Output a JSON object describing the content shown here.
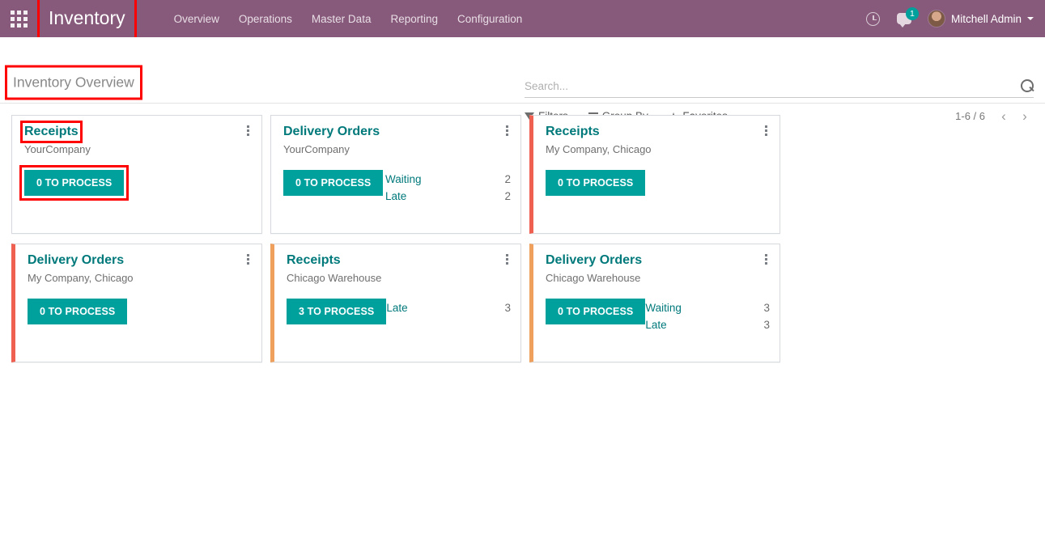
{
  "navbar": {
    "apps_icon": "apps-grid-icon",
    "brand": "Inventory",
    "menus": [
      "Overview",
      "Operations",
      "Master Data",
      "Reporting",
      "Configuration"
    ],
    "activities_icon": "clock-icon",
    "messages_icon": "chat-bubble-icon",
    "messages_count": "1",
    "user_name": "Mitchell Admin",
    "brand_color": "#875A7B"
  },
  "control_panel": {
    "breadcrumb": "Inventory Overview",
    "search": {
      "value": "",
      "placeholder": "Search...",
      "icon": "search-icon"
    },
    "filters_label": "Filters",
    "group_by_label": "Group By",
    "favorites_label": "Favorites",
    "pager": {
      "text": "1-6 / 6",
      "prev": "‹",
      "next": "›"
    }
  },
  "highlights": {
    "color": "#FF0000",
    "targets": [
      "brand",
      "breadcrumb",
      "card-0-title",
      "card-0-button"
    ]
  },
  "colors": {
    "accent_teal": "#00A09D",
    "title_teal": "#00797B",
    "stripe_red": "#F06050",
    "stripe_orange": "#EFA05C"
  },
  "kanban": {
    "cards": [
      {
        "title": "Receipts",
        "subtitle": "YourCompany",
        "button": "0 TO PROCESS",
        "stripe": "none",
        "stats": []
      },
      {
        "title": "Delivery Orders",
        "subtitle": "YourCompany",
        "button": "0 TO PROCESS",
        "stripe": "none",
        "stats": [
          {
            "label": "Waiting",
            "value": "2"
          },
          {
            "label": "Late",
            "value": "2"
          }
        ]
      },
      {
        "title": "Receipts",
        "subtitle": "My Company, Chicago",
        "button": "0 TO PROCESS",
        "stripe": "red",
        "stats": []
      },
      {
        "title": "Delivery Orders",
        "subtitle": "My Company, Chicago",
        "button": "0 TO PROCESS",
        "stripe": "red",
        "stats": []
      },
      {
        "title": "Receipts",
        "subtitle": "Chicago Warehouse",
        "button": "3 TO PROCESS",
        "stripe": "orange",
        "stats": [
          {
            "label": "Late",
            "value": "3"
          }
        ]
      },
      {
        "title": "Delivery Orders",
        "subtitle": "Chicago Warehouse",
        "button": "0 TO PROCESS",
        "stripe": "orange",
        "stats": [
          {
            "label": "Waiting",
            "value": "3"
          },
          {
            "label": "Late",
            "value": "3"
          }
        ]
      }
    ]
  }
}
